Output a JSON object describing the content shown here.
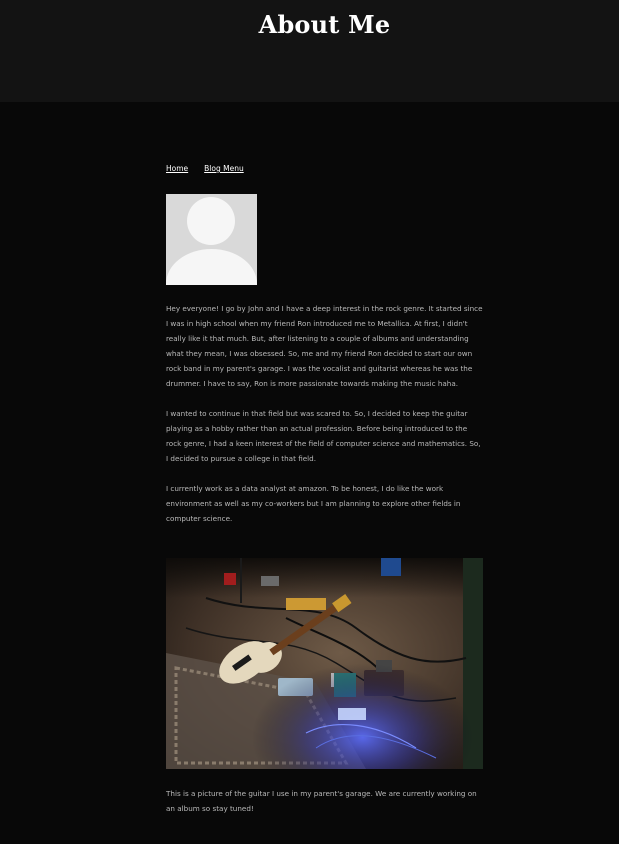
{
  "header": {
    "title": "About Me"
  },
  "nav": {
    "home": "Home",
    "blog_menu": "Blog Menu"
  },
  "paragraphs": [
    "Hey everyone! I go by John and I have a deep interest in the rock genre. It started since I was in high school when my friend Ron introduced me to Metallica. At first, I didn't really like it that much. But, after listening to a couple of albums and understanding what they mean, I was obsessed. So, me and my friend Ron decided to start our own rock band in my parent's garage. I was the vocalist and guitarist whereas he was the drummer. I have to say, Ron is more passionate towards making the music haha.",
    "I wanted to continue in that field but was scared to. So, I decided to keep the guitar playing as a hobby rather than an actual profession. Before being introduced to the rock genre, I had a keen interest of the field of computer science and mathematics. So, I decided to pursue a college in that field.",
    "I currently work as a data analyst at amazon. To be honest, I do like the work environment as well as my co-workers but I am planning to explore other fields in computer science."
  ],
  "caption": "This is a picture of the guitar I use in my parent's garage. We are currently working on an album so stay tuned!"
}
